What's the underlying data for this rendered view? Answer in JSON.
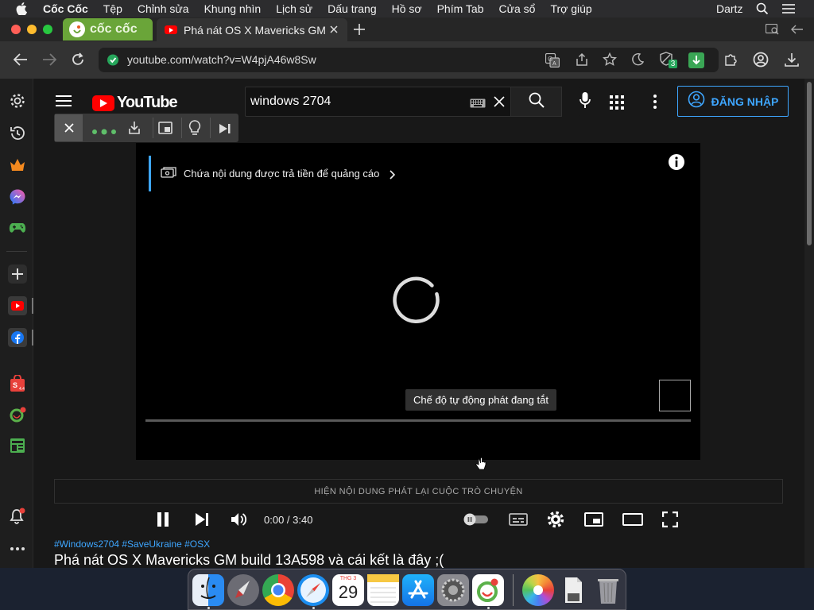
{
  "menubar": {
    "app_name": "Cốc Cốc",
    "items": [
      "Tệp",
      "Chỉnh sửa",
      "Khung nhìn",
      "Lịch sử",
      "Dấu trang",
      "Hồ sơ",
      "Phím Tab",
      "Cửa sổ",
      "Trợ giúp"
    ],
    "user": "Dartz"
  },
  "browser": {
    "tabs": [
      {
        "label": "cốc cốc"
      },
      {
        "label": "Phá nát OS X Mavericks GM"
      }
    ],
    "address": "youtube.com/watch?v=W4pjA46w8Sw",
    "shield_count": "3"
  },
  "youtube": {
    "logo_text": "YouTube",
    "search_value": "windows 2704",
    "signin_label": "ĐĂNG NHẬP",
    "ad_notice": "Chứa nội dung được trả tiền để quảng cáo",
    "autoplay_tooltip": "Chế độ tự động phát đang tắt",
    "time": "0:00 / 3:40",
    "progress": 0,
    "chat_replay_label": "HIỆN NỘI DUNG PHÁT LẠI CUỘC TRÒ CHUYỆN",
    "hashtags": "#Windows2704 #SaveUkraine #OSX",
    "video_title": "Phá nát OS X Mavericks GM build 13A598 và cái kết là đây ;("
  },
  "dock": {
    "calendar_month": "THG 3",
    "calendar_day": "29"
  },
  "colors": {
    "youtube_red": "#ff0000",
    "coccoc_green": "#6aa539",
    "signin_blue": "#3ea6ff",
    "page_bg": "#181818"
  }
}
